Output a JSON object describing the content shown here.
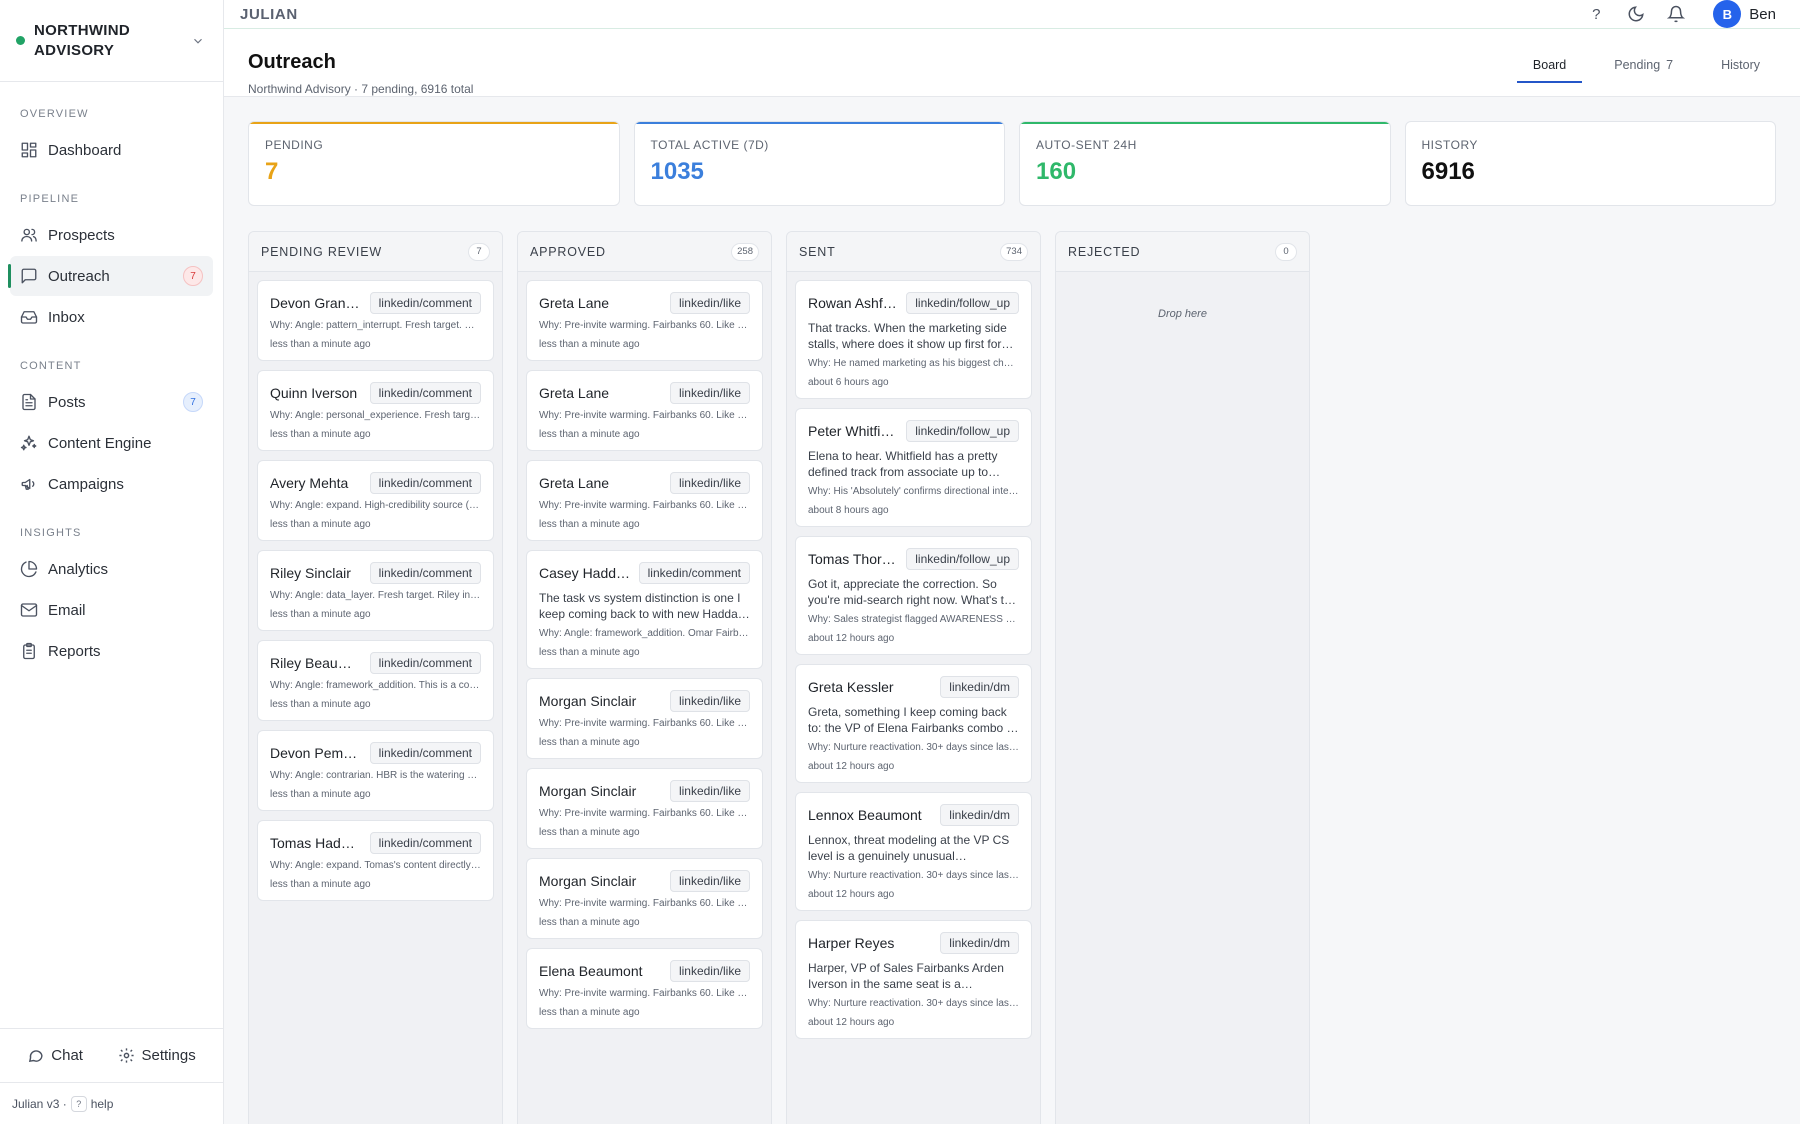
{
  "sidebar": {
    "brand": "NORTHWIND ADVISORY",
    "sections": [
      {
        "title": "OVERVIEW",
        "items": [
          {
            "label": "Dashboard",
            "icon": "dashboard-icon"
          }
        ]
      },
      {
        "title": "PIPELINE",
        "items": [
          {
            "label": "Prospects",
            "icon": "users-icon"
          },
          {
            "label": "Outreach",
            "icon": "message-icon",
            "badge": "7",
            "active": true
          },
          {
            "label": "Inbox",
            "icon": "inbox-icon"
          }
        ]
      },
      {
        "title": "CONTENT",
        "items": [
          {
            "label": "Posts",
            "icon": "document-icon",
            "badge": "7"
          },
          {
            "label": "Content Engine",
            "icon": "sparkles-icon"
          },
          {
            "label": "Campaigns",
            "icon": "megaphone-icon"
          }
        ]
      },
      {
        "title": "INSIGHTS",
        "items": [
          {
            "label": "Analytics",
            "icon": "pie-chart-icon"
          },
          {
            "label": "Email",
            "icon": "mail-icon"
          },
          {
            "label": "Reports",
            "icon": "clipboard-icon"
          }
        ]
      }
    ],
    "chat_label": "Chat",
    "settings_label": "Settings",
    "footer_version": "Julian v3 ·",
    "footer_key": "?",
    "footer_help": "help"
  },
  "topbar": {
    "title": "JULIAN",
    "help": "?",
    "user_initial": "B",
    "user_name": "Ben"
  },
  "page": {
    "title": "Outreach",
    "subtitle": "Northwind Advisory · 7 pending, 6916 total",
    "tabs": [
      {
        "label": "Board",
        "count": ""
      },
      {
        "label": "Pending",
        "count": "7"
      },
      {
        "label": "History",
        "count": ""
      }
    ]
  },
  "stats": [
    {
      "label": "PENDING",
      "value": "7",
      "color": "#e8a317"
    },
    {
      "label": "TOTAL ACTIVE (7D)",
      "value": "1035",
      "color": "#3b7fdc"
    },
    {
      "label": "AUTO-SENT 24H",
      "value": "160",
      "color": "#2fb86a"
    },
    {
      "label": "HISTORY",
      "value": "6916",
      "color": "#111111"
    }
  ],
  "columns": [
    {
      "title": "PENDING REVIEW",
      "count": "7",
      "cards": [
        {
          "name": "Devon Gran…",
          "channel": "linkedin/comment",
          "msg": "",
          "why": "Why: Angle: pattern_interrupt. Fresh target. D…",
          "time": "less than a minute ago"
        },
        {
          "name": "Quinn Iverson",
          "channel": "linkedin/comment",
          "msg": "",
          "why": "Why: Angle: personal_experience. Fresh targ…",
          "time": "less than a minute ago"
        },
        {
          "name": "Avery Mehta",
          "channel": "linkedin/comment",
          "msg": "",
          "why": "Why: Angle: expand. High-credibility source (…",
          "time": "less than a minute ago"
        },
        {
          "name": "Riley Sinclair",
          "channel": "linkedin/comment",
          "msg": "",
          "why": "Why: Angle: data_layer. Fresh target. Riley in…",
          "time": "less than a minute ago"
        },
        {
          "name": "Riley Beau…",
          "channel": "linkedin/comment",
          "msg": "",
          "why": "Why: Angle: framework_addition. This is a co…",
          "time": "less than a minute ago"
        },
        {
          "name": "Devon Pem…",
          "channel": "linkedin/comment",
          "msg": "",
          "why": "Why: Angle: contrarian. HBR is the watering …",
          "time": "less than a minute ago"
        },
        {
          "name": "Tomas Hadd…",
          "channel": "linkedin/comment",
          "msg": "",
          "why": "Why: Angle: expand. Tomas's content directly…",
          "time": "less than a minute ago"
        }
      ]
    },
    {
      "title": "APPROVED",
      "count": "258",
      "cards": [
        {
          "name": "Greta Lane",
          "channel": "linkedin/like",
          "msg": "",
          "why": "Why: Pre-invite warming. Fairbanks 60. Like t…",
          "time": "less than a minute ago"
        },
        {
          "name": "Greta Lane",
          "channel": "linkedin/like",
          "msg": "",
          "why": "Why: Pre-invite warming. Fairbanks 60. Like t…",
          "time": "less than a minute ago"
        },
        {
          "name": "Greta Lane",
          "channel": "linkedin/like",
          "msg": "",
          "why": "Why: Pre-invite warming. Fairbanks 60. Like t…",
          "time": "less than a minute ago"
        },
        {
          "name": "Casey Hadd…",
          "channel": "linkedin/comment",
          "msg": "The task vs system distinction is one I keep coming back to with new Hadda…",
          "why": "Why: Angle: framework_addition. Omar Fairb…",
          "time": "less than a minute ago"
        },
        {
          "name": "Morgan Sinclair",
          "channel": "linkedin/like",
          "msg": "",
          "why": "Why: Pre-invite warming. Fairbanks 60. Like t…",
          "time": "less than a minute ago"
        },
        {
          "name": "Morgan Sinclair",
          "channel": "linkedin/like",
          "msg": "",
          "why": "Why: Pre-invite warming. Fairbanks 60. Like t…",
          "time": "less than a minute ago"
        },
        {
          "name": "Morgan Sinclair",
          "channel": "linkedin/like",
          "msg": "",
          "why": "Why: Pre-invite warming. Fairbanks 60. Like t…",
          "time": "less than a minute ago"
        },
        {
          "name": "Elena Beaumont",
          "channel": "linkedin/like",
          "msg": "",
          "why": "Why: Pre-invite warming. Fairbanks 60. Like t…",
          "time": "less than a minute ago"
        }
      ]
    },
    {
      "title": "SENT",
      "count": "734",
      "cards": [
        {
          "name": "Rowan Ashf…",
          "channel": "linkedin/follow_up",
          "msg": "That tracks. When the marketing side stalls, where does it show up first for…",
          "why": "Why: He named marketing as his biggest cha…",
          "time": "about 6 hours ago"
        },
        {
          "name": "Peter Whitfield",
          "channel": "linkedin/follow_up",
          "msg": "Elena to hear. Whitfield has a pretty defined track from associate up to VP…",
          "why": "Why: His 'Absolutely' confirms directional inte…",
          "time": "about 8 hours ago"
        },
        {
          "name": "Tomas Thor…",
          "channel": "linkedin/follow_up",
          "msg": "Got it, appreciate the correction. So you're mid-search right now. What's t…",
          "why": "Why: Sales strategist flagged AWARENESS …",
          "time": "about 12 hours ago"
        },
        {
          "name": "Greta Kessler",
          "channel": "linkedin/dm",
          "msg": "Greta, something I keep coming back to: the VP of Elena Fairbanks combo …",
          "why": "Why: Nurture reactivation. 30+ days since las…",
          "time": "about 12 hours ago"
        },
        {
          "name": "Lennox Beaumont",
          "channel": "linkedin/dm",
          "msg": "Lennox, threat modeling at the VP CS level is a genuinely unusual…",
          "why": "Why: Nurture reactivation. 30+ days since las…",
          "time": "about 12 hours ago"
        },
        {
          "name": "Harper Reyes",
          "channel": "linkedin/dm",
          "msg": "Harper, VP of Sales Fairbanks Arden Iverson in the same seat is a…",
          "why": "Why: Nurture reactivation. 30+ days since las…",
          "time": "about 12 hours ago"
        }
      ]
    },
    {
      "title": "REJECTED",
      "count": "0",
      "cards": [],
      "empty": "Drop here"
    }
  ]
}
